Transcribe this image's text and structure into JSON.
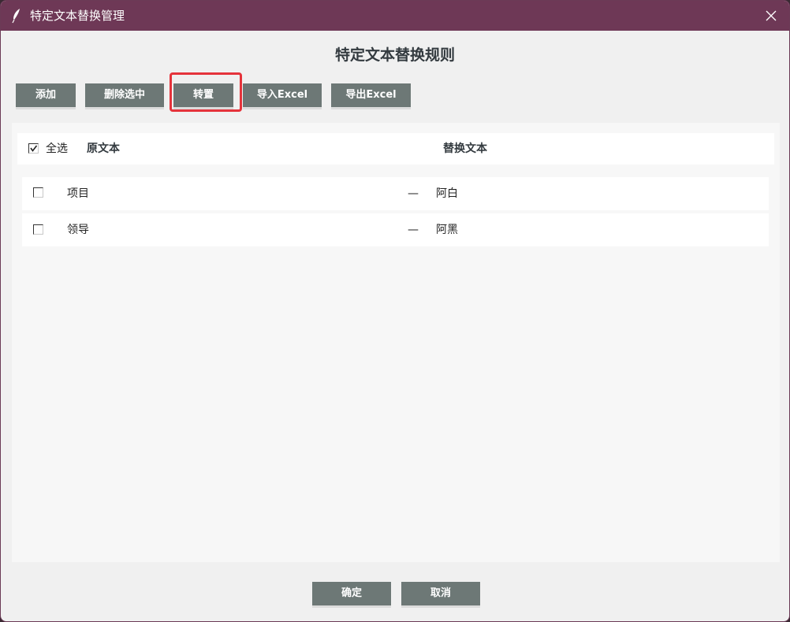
{
  "window": {
    "title": "特定文本替换管理"
  },
  "page": {
    "title": "特定文本替换规则"
  },
  "toolbar": {
    "add_label": "添加",
    "delete_label": "删除选中",
    "transpose_label": "转置",
    "import_label": "导入Excel",
    "export_label": "导出Excel"
  },
  "table": {
    "select_all_label": "全选",
    "select_all_checked": true,
    "col_original": "原文本",
    "col_replacement": "替换文本",
    "rows": [
      {
        "checked": false,
        "original": "项目",
        "separator": "—",
        "replacement": "阿白"
      },
      {
        "checked": false,
        "original": "领导",
        "separator": "—",
        "replacement": "阿黑"
      }
    ]
  },
  "footer": {
    "ok_label": "确定",
    "cancel_label": "取消"
  },
  "colors": {
    "titlebar": "#6e3856",
    "button": "#6d7876",
    "highlight": "#e5333b"
  },
  "icons": {
    "app": "feather-icon",
    "close": "close-icon",
    "check": "checkmark-icon"
  }
}
